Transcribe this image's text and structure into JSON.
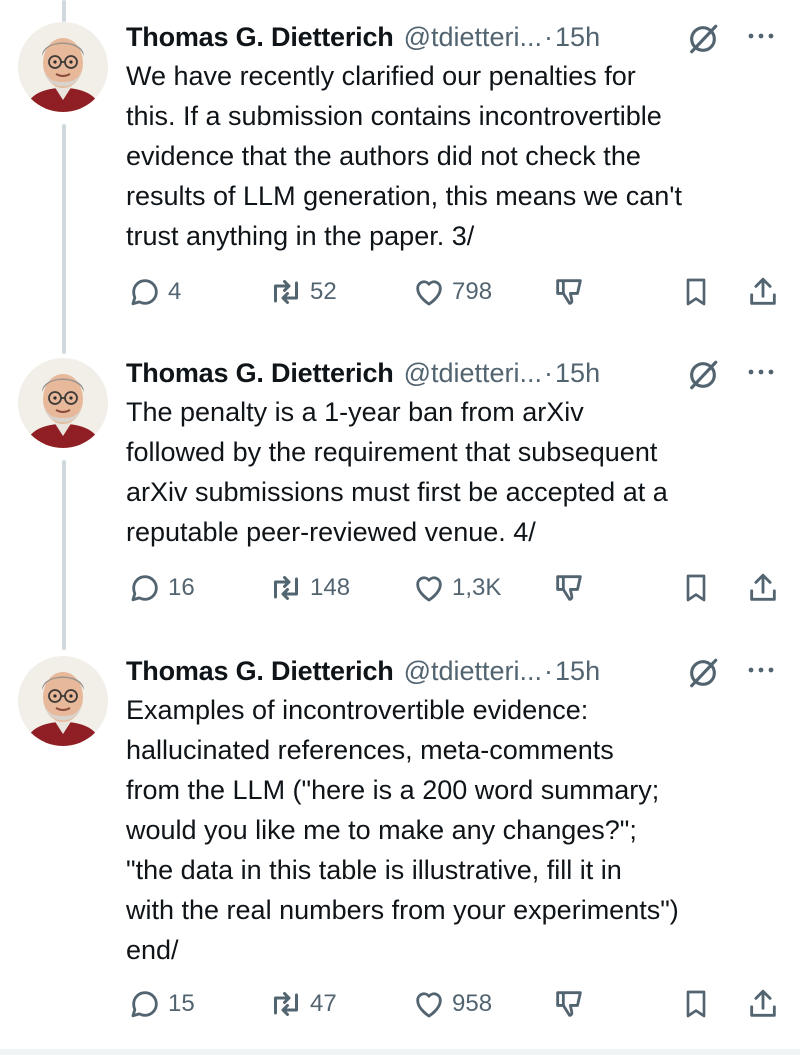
{
  "author": {
    "name": "Thomas G. Dietterich",
    "handle": "@tdietteri...",
    "separator": "·",
    "avatar": "profile-photo"
  },
  "tweets": [
    {
      "time": "15h",
      "text": "We have recently clarified our penalties for\nthis. If a submission contains incontrovertible\nevidence that the authors did not check the\nresults of LLM generation, this means we can't\ntrust anything in the paper. 3/",
      "replies": "4",
      "reposts": "52",
      "likes": "798"
    },
    {
      "time": "15h",
      "text": "The penalty is a 1-year ban from arXiv\nfollowed by the requirement that subsequent\narXiv submissions must first be accepted at a\nreputable peer-reviewed venue. 4/",
      "replies": "16",
      "reposts": "148",
      "likes": "1,3K"
    },
    {
      "time": "15h",
      "text": "Examples of incontrovertible evidence:\nhallucinated references, meta-comments\nfrom the LLM (\"here is a 200 word summary;\nwould you like me to make any changes?\";\n\"the data in this table is illustrative, fill it in\nwith the real numbers from your experiments\")\nend/",
      "replies": "15",
      "reposts": "47",
      "likes": "958"
    }
  ],
  "icons": {
    "reply": "reply-icon",
    "repost": "repost-icon",
    "like": "heart-icon",
    "dislike": "thumbs-down-icon",
    "bookmark": "bookmark-icon",
    "share": "share-icon",
    "grok": "grok-icon",
    "more": "more-icon"
  },
  "colors": {
    "text": "#0f1419",
    "secondary": "#536471",
    "thread_line": "#cfd9de"
  }
}
